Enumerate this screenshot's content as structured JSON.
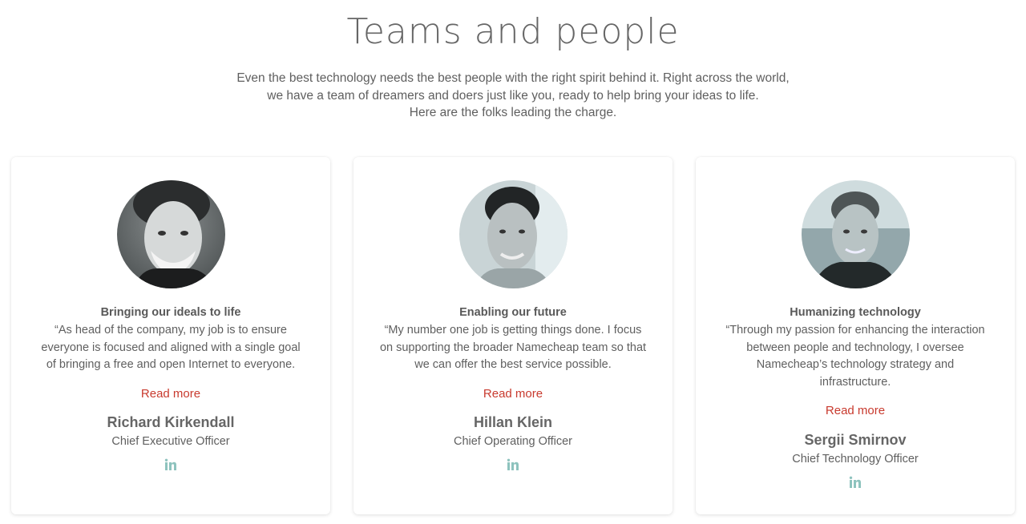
{
  "section": {
    "title": "Teams and people",
    "intro_lines": [
      "Even the best technology needs the best people with the right spirit behind it. Right across the world,",
      "we have a team of dreamers and doers just like you, ready to help bring your ideas to life.",
      "Here are the folks leading the charge."
    ]
  },
  "cards": [
    {
      "title": "Bringing our ideals to life",
      "quote": "“As head of the company, my job is to ensure everyone is focused and aligned with a single goal of bringing a free and open Internet to everyone.",
      "read_more": "Read more",
      "name": "Richard Kirkendall",
      "role": "Chief Executive Officer",
      "social_icon": "linkedin-icon"
    },
    {
      "title": "Enabling our future",
      "quote": "“My number one job is getting things done. I focus on supporting the broader Namecheap team so that we can offer the best service possible.",
      "read_more": "Read more",
      "name": "Hillan Klein",
      "role": "Chief Operating Officer",
      "social_icon": "linkedin-icon"
    },
    {
      "title": "Humanizing technology",
      "quote": "“Through my passion for enhancing the interaction between people and technology, I oversee Namecheap’s technology strategy and infrastructure.",
      "read_more": "Read more",
      "name": "Sergii Smirnov",
      "role": "Chief Technology Officer",
      "social_icon": "linkedin-icon"
    }
  ],
  "colors": {
    "link": "#c83a2e",
    "social_icon": "#8ec3be",
    "text": "#5f5f5f"
  }
}
